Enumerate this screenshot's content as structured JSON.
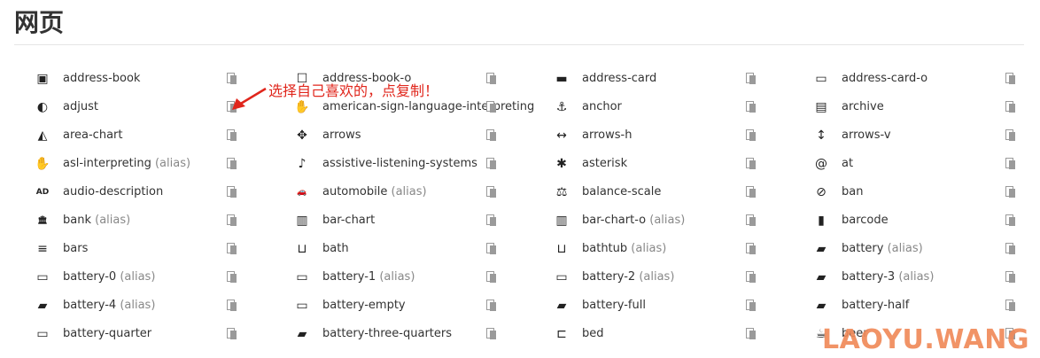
{
  "page": {
    "title": "网页"
  },
  "icons": [
    {
      "name": "address-book",
      "glyph": "▣",
      "icon": "address-book-icon"
    },
    {
      "name": "address-book-o",
      "glyph": "☐",
      "icon": "address-book-o-icon"
    },
    {
      "name": "address-card",
      "glyph": "▬",
      "icon": "address-card-icon"
    },
    {
      "name": "address-card-o",
      "glyph": "▭",
      "icon": "address-card-o-icon"
    },
    {
      "name": "adjust",
      "glyph": "◐",
      "icon": "adjust-icon"
    },
    {
      "name": "american-sign-language-interpreting",
      "glyph": "✋",
      "icon": "american-sign-language-interpreting-icon"
    },
    {
      "name": "anchor",
      "glyph": "⚓",
      "icon": "anchor-icon"
    },
    {
      "name": "archive",
      "glyph": "▤",
      "icon": "archive-icon"
    },
    {
      "name": "area-chart",
      "glyph": "◭",
      "icon": "area-chart-icon"
    },
    {
      "name": "arrows",
      "glyph": "✥",
      "icon": "arrows-icon"
    },
    {
      "name": "arrows-h",
      "glyph": "↔",
      "icon": "arrows-h-icon"
    },
    {
      "name": "arrows-v",
      "glyph": "↕",
      "icon": "arrows-v-icon"
    },
    {
      "name": "asl-interpreting",
      "alias": "(alias)",
      "glyph": "✋",
      "icon": "asl-interpreting-icon"
    },
    {
      "name": "assistive-listening-systems",
      "glyph": "♪",
      "icon": "assistive-listening-systems-icon"
    },
    {
      "name": "asterisk",
      "glyph": "✱",
      "icon": "asterisk-icon"
    },
    {
      "name": "at",
      "glyph": "@",
      "icon": "at-icon"
    },
    {
      "name": "audio-description",
      "glyph": "AD",
      "icon": "audio-description-icon"
    },
    {
      "name": "automobile",
      "alias": "(alias)",
      "glyph": "🚗",
      "icon": "automobile-icon"
    },
    {
      "name": "balance-scale",
      "glyph": "⚖",
      "icon": "balance-scale-icon"
    },
    {
      "name": "ban",
      "glyph": "⊘",
      "icon": "ban-icon"
    },
    {
      "name": "bank",
      "alias": "(alias)",
      "glyph": "🏛",
      "icon": "bank-icon"
    },
    {
      "name": "bar-chart",
      "glyph": "▥",
      "icon": "bar-chart-icon"
    },
    {
      "name": "bar-chart-o",
      "alias": "(alias)",
      "glyph": "▥",
      "icon": "bar-chart-o-icon"
    },
    {
      "name": "barcode",
      "glyph": "▮",
      "icon": "barcode-icon"
    },
    {
      "name": "bars",
      "glyph": "≡",
      "icon": "bars-icon"
    },
    {
      "name": "bath",
      "glyph": "⊔",
      "icon": "bath-icon"
    },
    {
      "name": "bathtub",
      "alias": "(alias)",
      "glyph": "⊔",
      "icon": "bathtub-icon"
    },
    {
      "name": "battery",
      "alias": "(alias)",
      "glyph": "▰",
      "icon": "battery-icon"
    },
    {
      "name": "battery-0",
      "alias": "(alias)",
      "glyph": "▭",
      "icon": "battery-0-icon"
    },
    {
      "name": "battery-1",
      "alias": "(alias)",
      "glyph": "▭",
      "icon": "battery-1-icon"
    },
    {
      "name": "battery-2",
      "alias": "(alias)",
      "glyph": "▭",
      "icon": "battery-2-icon"
    },
    {
      "name": "battery-3",
      "alias": "(alias)",
      "glyph": "▰",
      "icon": "battery-3-icon"
    },
    {
      "name": "battery-4",
      "alias": "(alias)",
      "glyph": "▰",
      "icon": "battery-4-icon"
    },
    {
      "name": "battery-empty",
      "glyph": "▭",
      "icon": "battery-empty-icon"
    },
    {
      "name": "battery-full",
      "glyph": "▰",
      "icon": "battery-full-icon"
    },
    {
      "name": "battery-half",
      "glyph": "▰",
      "icon": "battery-half-icon"
    },
    {
      "name": "battery-quarter",
      "glyph": "▭",
      "icon": "battery-quarter-icon"
    },
    {
      "name": "battery-three-quarters",
      "glyph": "▰",
      "icon": "battery-three-quarters-icon"
    },
    {
      "name": "bed",
      "glyph": "⊏",
      "icon": "bed-icon"
    },
    {
      "name": "beer",
      "glyph": "☕",
      "icon": "beer-icon"
    }
  ],
  "annotation": {
    "text": "选择自己喜欢的，点复制！",
    "color": "#e0261c"
  },
  "watermark": {
    "text": "LAOYU.WANG",
    "color": "#f08a5a"
  }
}
